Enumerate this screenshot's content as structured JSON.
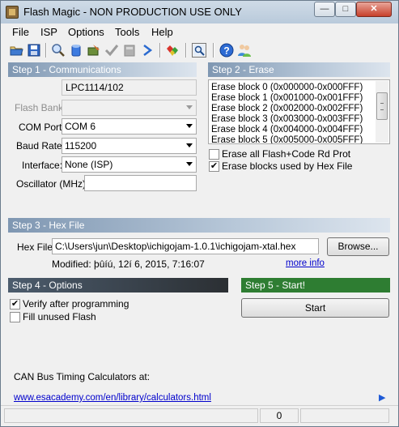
{
  "window": {
    "title": "Flash Magic - NON PRODUCTION USE ONLY",
    "minimize_glyph": "—",
    "maximize_glyph": "□",
    "close_glyph": "✕"
  },
  "menu": [
    "File",
    "ISP",
    "Options",
    "Tools",
    "Help"
  ],
  "toolbar_icons": [
    "open-folder-icon",
    "save-icon",
    "find-icon",
    "erase-bucket-icon",
    "program-icon",
    "verify-check-icon",
    "blank-check-icon",
    "go-arrow-icon",
    "gems-icon",
    "sheet-preview-icon",
    "help-icon",
    "users-icon"
  ],
  "step1": {
    "header": "Step 1 - Communications",
    "device": "LPC1114/102",
    "flash_bank_label": "Flash Bank:",
    "flash_bank_value": "",
    "com_port_label": "COM Port:",
    "com_port_value": "COM 6",
    "baud_label": "Baud Rate:",
    "baud_value": "115200",
    "interface_label": "Interface:",
    "interface_value": "None (ISP)",
    "osc_label": "Oscillator (MHz):",
    "osc_value": ""
  },
  "step2": {
    "header": "Step 2 - Erase",
    "blocks": [
      "Erase block 0 (0x000000-0x000FFF)",
      "Erase block 1 (0x001000-0x001FFF)",
      "Erase block 2 (0x002000-0x002FFF)",
      "Erase block 3 (0x003000-0x003FFF)",
      "Erase block 4 (0x004000-0x004FFF)",
      "Erase block 5 (0x005000-0x005FFF)"
    ],
    "erase_all_label": "Erase all Flash+Code Rd Prot",
    "erase_all_checked": false,
    "erase_used_label": "Erase blocks used by Hex File",
    "erase_used_checked": true
  },
  "step3": {
    "header": "Step 3 - Hex File",
    "hex_label": "Hex File:",
    "hex_path": "C:\\Users\\jun\\Desktop\\ichigojam-1.0.1\\ichigojam-xtal.hex",
    "browse_label": "Browse...",
    "modified_text": "Modified: þûíú, 12í 6, 2015, 7:16:07",
    "more_info_label": "more info"
  },
  "step4": {
    "header": "Step 4 - Options",
    "verify_label": "Verify after programming",
    "verify_checked": true,
    "fill_label": "Fill unused Flash",
    "fill_checked": false
  },
  "step5": {
    "header": "Step 5 - Start!",
    "start_label": "Start"
  },
  "info": {
    "can_text": "CAN Bus Timing Calculators at:",
    "link": "www.esacademy.com/en/library/calculators.html",
    "next_glyph": "▶"
  },
  "status": {
    "count": "0"
  },
  "colors": {
    "step_gradient_light": "#7f97b2",
    "step_dark": "#2b2f33",
    "step_start": "#2e7d32",
    "link": "#0000cc"
  }
}
